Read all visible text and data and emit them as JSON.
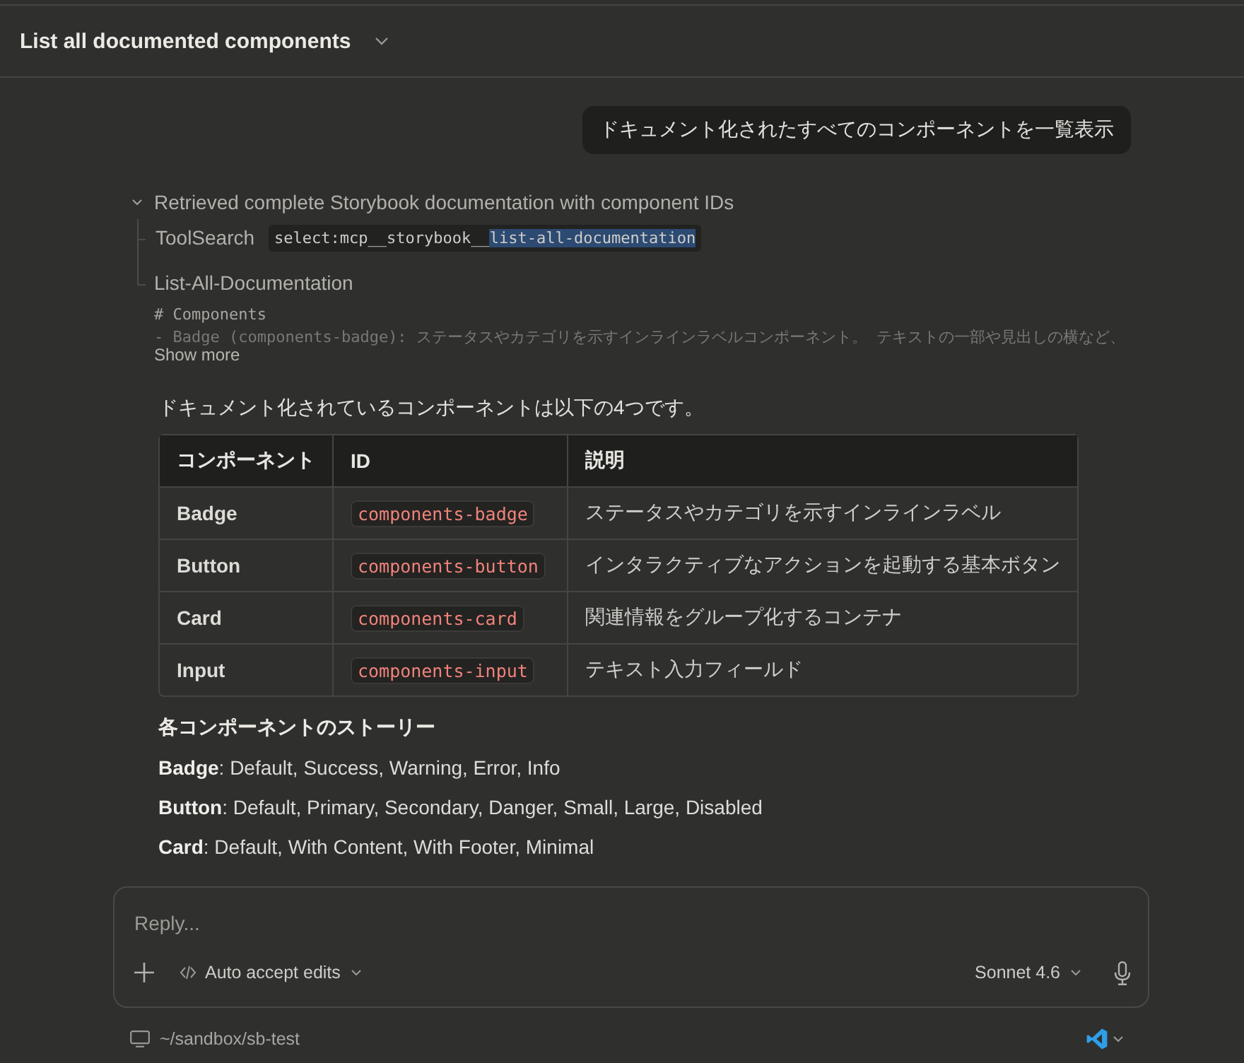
{
  "header": {
    "title": "List all documented components"
  },
  "user_message": "ドキュメント化されたすべてのコンポーネントを一覧表示",
  "tool_group": {
    "summary": "Retrieved complete Storybook documentation with component IDs",
    "expanded": true,
    "steps": [
      {
        "kind": "search",
        "name": "ToolSearch",
        "query_parts": [
          {
            "text": "select:mcp__storybook__",
            "selected": false
          },
          {
            "text": "list-all-documentation",
            "selected": true
          }
        ]
      },
      {
        "kind": "result",
        "name": "List-All-Documentation",
        "output_lines": [
          "# Components",
          "- Badge (components-badge): ステータスやカテゴリを示すインラインラベルコンポーネント。 テキストの一部や見出しの横など、"
        ],
        "more_label": "Show more"
      }
    ]
  },
  "intro": "ドキュメント化されているコンポーネントは以下の4つです。",
  "table": {
    "columns": [
      "コンポーネント",
      "ID",
      "説明"
    ],
    "rows": [
      [
        "Badge",
        "components-badge",
        "ステータスやカテゴリを示すインラインラベル"
      ],
      [
        "Button",
        "components-button",
        "インタラクティブなアクションを起動する基本ボタン"
      ],
      [
        "Card",
        "components-card",
        "関連情報をグループ化するコンテナ"
      ],
      [
        "Input",
        "components-input",
        "テキスト入力フィールド"
      ]
    ]
  },
  "stories_heading": "各コンポーネントのストーリー",
  "stories": [
    "**Badge**: Default, Success, Warning, Error, Info",
    "**Button**: Default, Primary, Secondary, Danger, Small, Large, Disabled",
    "**Card**: Default, With Content, With Footer, Minimal"
  ],
  "composer": {
    "placeholder": "Reply...",
    "mode": "Auto accept edits",
    "model": "Sonnet 4.6"
  },
  "footer": {
    "path": "~/sandbox/sb-test"
  }
}
